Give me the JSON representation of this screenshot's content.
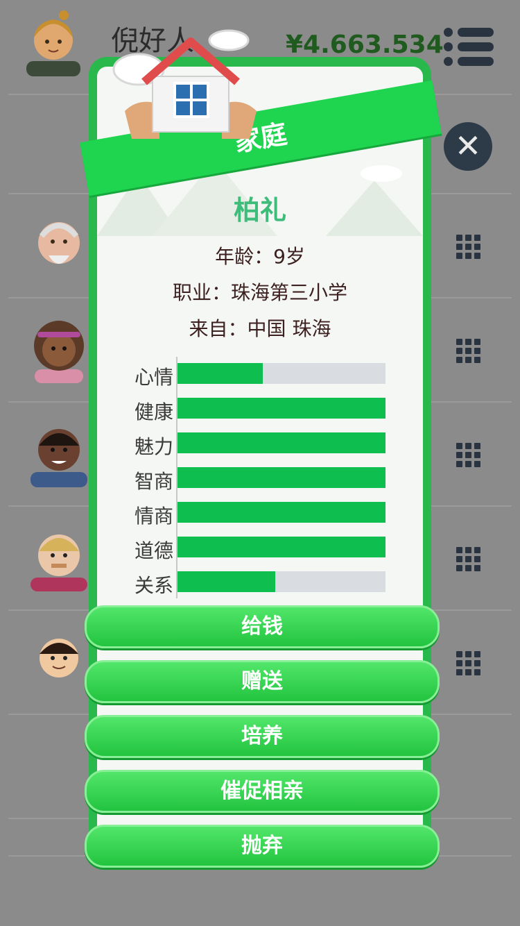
{
  "header": {
    "player_name": "倪好人",
    "money": "¥4.663.534",
    "menu_icon": "menu-icon"
  },
  "dialog": {
    "title": "家庭",
    "name": "柏礼",
    "age": "年龄：9岁",
    "job": "职业：珠海第三小学",
    "origin": "来自：中国 珠海",
    "stats": [
      {
        "label": "心情",
        "value": 0.41
      },
      {
        "label": "健康",
        "value": 1.0
      },
      {
        "label": "魅力",
        "value": 1.0
      },
      {
        "label": "智商",
        "value": 1.0
      },
      {
        "label": "情商",
        "value": 1.0
      },
      {
        "label": "道德",
        "value": 1.0
      },
      {
        "label": "关系",
        "value": 0.47
      }
    ],
    "buttons": [
      "给钱",
      "赠送",
      "培养",
      "催促相亲",
      "抛弃"
    ]
  },
  "colors": {
    "dialog_green": "#28b84c",
    "bar_fill": "#0ebf50",
    "name_green": "#3dbc7a",
    "close_bg": "#2d3b48"
  }
}
